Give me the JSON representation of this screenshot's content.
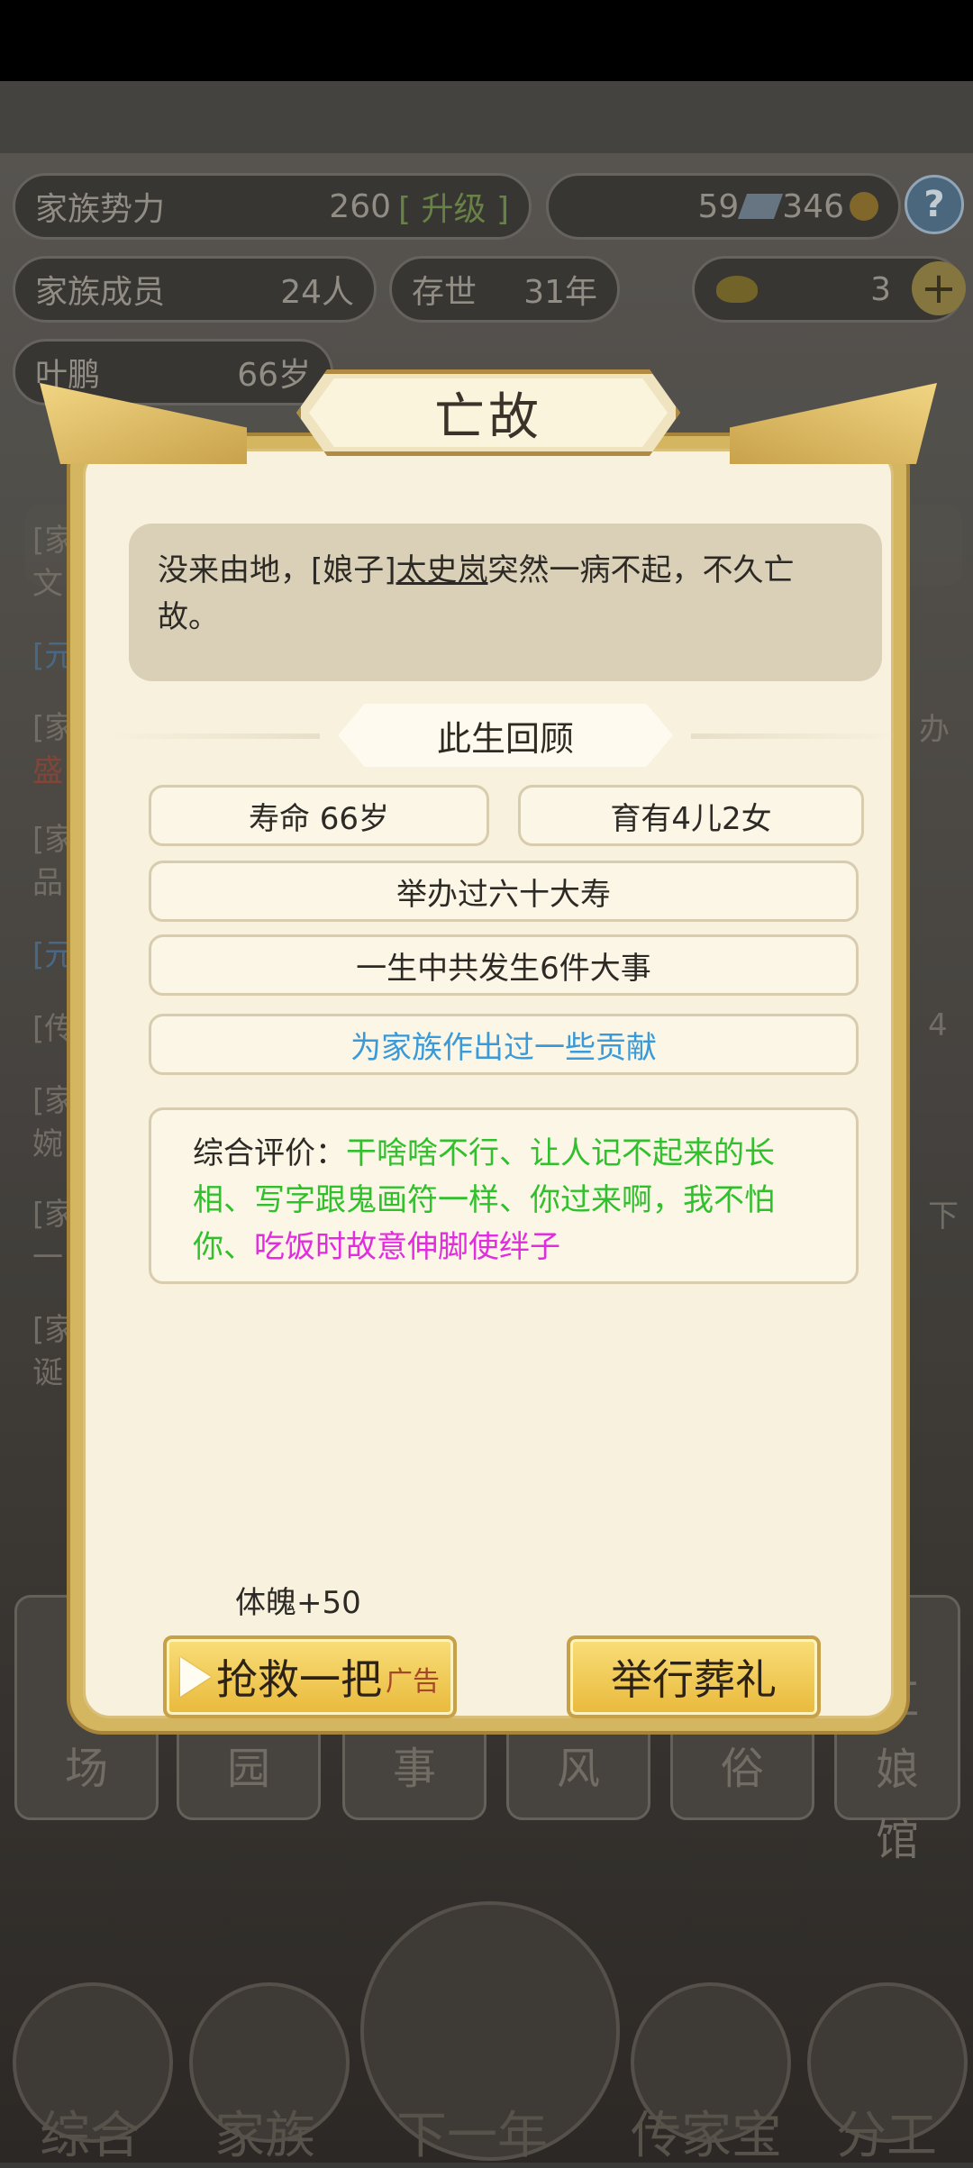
{
  "hud": {
    "family_power_label": "家族势力",
    "family_power_value": "260",
    "family_power_rank": "[ 升级 ]",
    "currency_a": "59",
    "currency_b": "346",
    "members_label": "家族成员",
    "members_value": "24人",
    "alive_label": "存世",
    "alive_value": "31年",
    "gold_value": "3",
    "person_name": "叶鹏",
    "person_age": "66岁",
    "help_label": "?",
    "plus_label": "+"
  },
  "background": {
    "row_texts": [
      "[家",
      "文",
      "[元",
      "[家",
      "盛",
      "[家",
      "品",
      "[元",
      "[传",
      "[家",
      "婉",
      "[家",
      "一",
      "[家",
      "诞"
    ],
    "bottom_tiles": [
      "场",
      "园",
      "事",
      "风",
      "俗",
      "红娘馆"
    ],
    "nav": [
      "综合",
      "家族",
      "下一年",
      "传家宝",
      "分工"
    ],
    "right_partial": [
      "办",
      "4",
      "下"
    ]
  },
  "modal": {
    "title": "亡故",
    "story_prefix": "没来由地，[娘子]",
    "story_name": "太史岚",
    "story_suffix": "突然一病不起，不久亡故。",
    "section_title": "此生回顾",
    "lifespan": "寿命 66岁",
    "children": "育有4儿2女",
    "birthday": "举办过六十大寿",
    "events": "一生中共发生6件大事",
    "contribution": "为家族作出过一些贡献",
    "eval_label": "综合评价：",
    "eval_green": "干啥啥不行、让人记不起来的长相、写字跟鬼画符一样、你过来啊，我不怕你、",
    "eval_magenta": "吃饭时故意伸脚使绊子",
    "bonus": "体魄+50",
    "rescue_label": "抢救一把",
    "ad_label": "广告",
    "funeral_label": "举行葬礼"
  },
  "colors": {
    "gold": "#e9b93b",
    "cream": "#f7f1dd",
    "green_trait": "#2fc02c",
    "magenta_trait": "#e32be0",
    "blue_text": "#3a9ad9"
  }
}
